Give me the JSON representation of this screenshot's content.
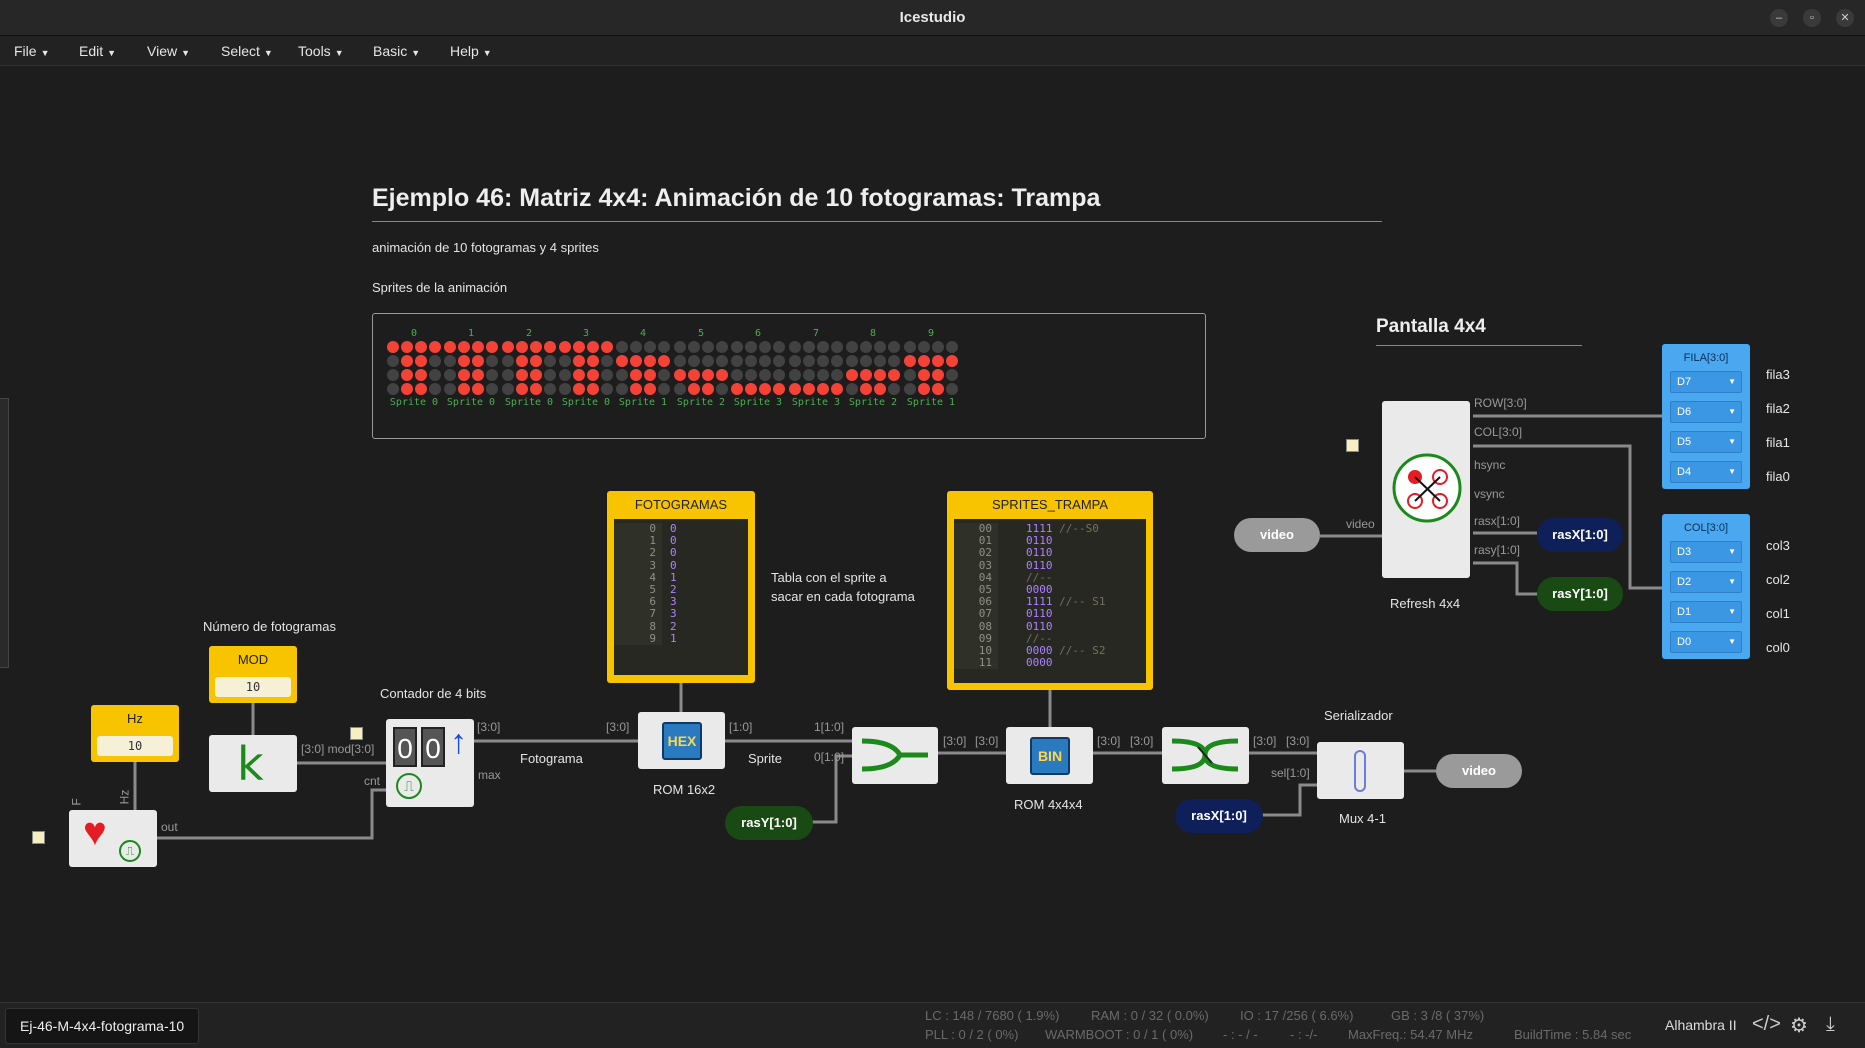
{
  "app": {
    "title": "Icestudio"
  },
  "menu": [
    "File",
    "Edit",
    "View",
    "Select",
    "Tools",
    "Basic",
    "Help"
  ],
  "doc": {
    "title": "Ejemplo 46: Matriz 4x4: Animación de 10 fotogramas: Trampa",
    "subtitle": "animación de 10 fotogramas y 4 sprites",
    "sprites_heading": "Sprites de la animación",
    "pantalla": "Pantalla 4x4",
    "note_numero": "Número de fotogramas",
    "note_contador": "Contador de 4 bits",
    "note_tabla": "Tabla con el sprite a\nsacar en cada fotograma",
    "note_serial": "Serializador"
  },
  "sprites": [
    {
      "num": "0",
      "cap": "Sprite 0",
      "on": [
        1,
        1,
        1,
        1,
        0,
        1,
        1,
        0,
        0,
        1,
        1,
        0,
        0,
        1,
        1,
        0
      ]
    },
    {
      "num": "1",
      "cap": "Sprite 0",
      "on": [
        1,
        1,
        1,
        1,
        0,
        1,
        1,
        0,
        0,
        1,
        1,
        0,
        0,
        1,
        1,
        0
      ]
    },
    {
      "num": "2",
      "cap": "Sprite 0",
      "on": [
        1,
        1,
        1,
        1,
        0,
        1,
        1,
        0,
        0,
        1,
        1,
        0,
        0,
        1,
        1,
        0
      ]
    },
    {
      "num": "3",
      "cap": "Sprite 0",
      "on": [
        1,
        1,
        1,
        1,
        0,
        1,
        1,
        0,
        0,
        1,
        1,
        0,
        0,
        1,
        1,
        0
      ]
    },
    {
      "num": "4",
      "cap": "Sprite 1",
      "on": [
        0,
        0,
        0,
        0,
        1,
        1,
        1,
        1,
        0,
        1,
        1,
        0,
        0,
        1,
        1,
        0
      ]
    },
    {
      "num": "5",
      "cap": "Sprite 2",
      "on": [
        0,
        0,
        0,
        0,
        0,
        0,
        0,
        0,
        1,
        1,
        1,
        1,
        0,
        1,
        1,
        0
      ]
    },
    {
      "num": "6",
      "cap": "Sprite 3",
      "on": [
        0,
        0,
        0,
        0,
        0,
        0,
        0,
        0,
        0,
        0,
        0,
        0,
        1,
        1,
        1,
        1
      ]
    },
    {
      "num": "7",
      "cap": "Sprite 3",
      "on": [
        0,
        0,
        0,
        0,
        0,
        0,
        0,
        0,
        0,
        0,
        0,
        0,
        1,
        1,
        1,
        1
      ]
    },
    {
      "num": "8",
      "cap": "Sprite 2",
      "on": [
        0,
        0,
        0,
        0,
        0,
        0,
        0,
        0,
        1,
        1,
        1,
        1,
        0,
        1,
        1,
        0
      ]
    },
    {
      "num": "9",
      "cap": "Sprite 1",
      "on": [
        0,
        0,
        0,
        0,
        1,
        1,
        1,
        1,
        0,
        1,
        1,
        0,
        0,
        1,
        1,
        0
      ]
    }
  ],
  "blocks": {
    "hz": {
      "title": "Hz",
      "value": "10"
    },
    "mod": {
      "title": "MOD",
      "value": "10"
    },
    "fotogramas": {
      "title": "FOTOGRAMAS",
      "lines": [
        "0",
        "1",
        "2",
        "3",
        "4",
        "5",
        "6",
        "7",
        "8",
        "9"
      ],
      "values": [
        "0",
        "0",
        "0",
        "0",
        "1",
        "2",
        "3",
        "3",
        "2",
        "1"
      ]
    },
    "sprites_trampa": {
      "title": "SPRITES_TRAMPA",
      "lines": [
        "00",
        "01",
        "02",
        "03",
        "04",
        "05",
        "06",
        "07",
        "08",
        "09",
        "10",
        "11"
      ],
      "values": [
        "1111 //--S0",
        "0110",
        "0110",
        "0110",
        "//--",
        "0000",
        "1111 //-- S1",
        "0110",
        "0110",
        "//--",
        "0000 //-- S2",
        "0000"
      ]
    },
    "rom16": "ROM 16x2",
    "rom4": "ROM 4x4x4",
    "mux": "Mux 4-1",
    "refresh": "Refresh 4x4"
  },
  "wires": {
    "fotograma": "Fotograma",
    "sprite": "Sprite",
    "w30a": "[3:0]",
    "w30b": "[3:0]",
    "w10": "[1:0]",
    "w110": "1[1:0]",
    "w010": "0[1:0]",
    "w30c": "[3:0]",
    "w30d": "[3:0]",
    "w30e": "[3:0]",
    "w30f": "[3:0]",
    "w30g": "[3:0]",
    "w30h": "[3:0]",
    "mod30": "[3:0] mod[3:0]",
    "cnt": "cnt",
    "max": "max",
    "out": "out",
    "sel": "sel[1:0]",
    "F": "F",
    "Hz": "Hz",
    "row": "ROW[3:0]",
    "col": "COL[3:0]",
    "hsync": "hsync",
    "vsync": "vsync",
    "rasx": "rasx[1:0]",
    "rasy": "rasy[1:0]",
    "video_in": "video"
  },
  "pills": {
    "video1": "video",
    "video2": "video",
    "rasX1": "rasX[1:0]",
    "rasY1": "rasY[1:0]",
    "rasY2": "rasY[1:0]",
    "rasX2": "rasX[1:0]"
  },
  "fila": {
    "title": "FILA[3:0]",
    "pins": [
      "D7",
      "D6",
      "D5",
      "D4"
    ],
    "names": [
      "fila3",
      "fila2",
      "fila1",
      "fila0"
    ]
  },
  "col": {
    "title": "COL[3:0]",
    "pins": [
      "D3",
      "D2",
      "D1",
      "D0"
    ],
    "names": [
      "col3",
      "col2",
      "col1",
      "col0"
    ]
  },
  "colors": {
    "led_on": "#f44336",
    "led_off": "#424242",
    "block_yellow": "#f8c400",
    "pin_blue": "#4aa8f0"
  },
  "status": {
    "project": "Ej-46-M-4x4-fotograma-10",
    "lc": "LC : 148 / 7680 ( 1.9%)",
    "ram": "RAM : 0 / 32 ( 0.0%)",
    "io": "IO : 17 /256 ( 6.6%)",
    "gb": "GB : 3 /8 ( 37%)",
    "pll": "PLL : 0 / 2 ( 0%)",
    "warmboot": "WARMBOOT : 0 / 1 ( 0%)",
    "dash1": "- : - / -",
    "dash2": "- : -/-",
    "maxfreq": "MaxFreq.: 54.47 MHz",
    "buildtime": "BuildTime : 5.84 sec",
    "board": "Alhambra II"
  }
}
